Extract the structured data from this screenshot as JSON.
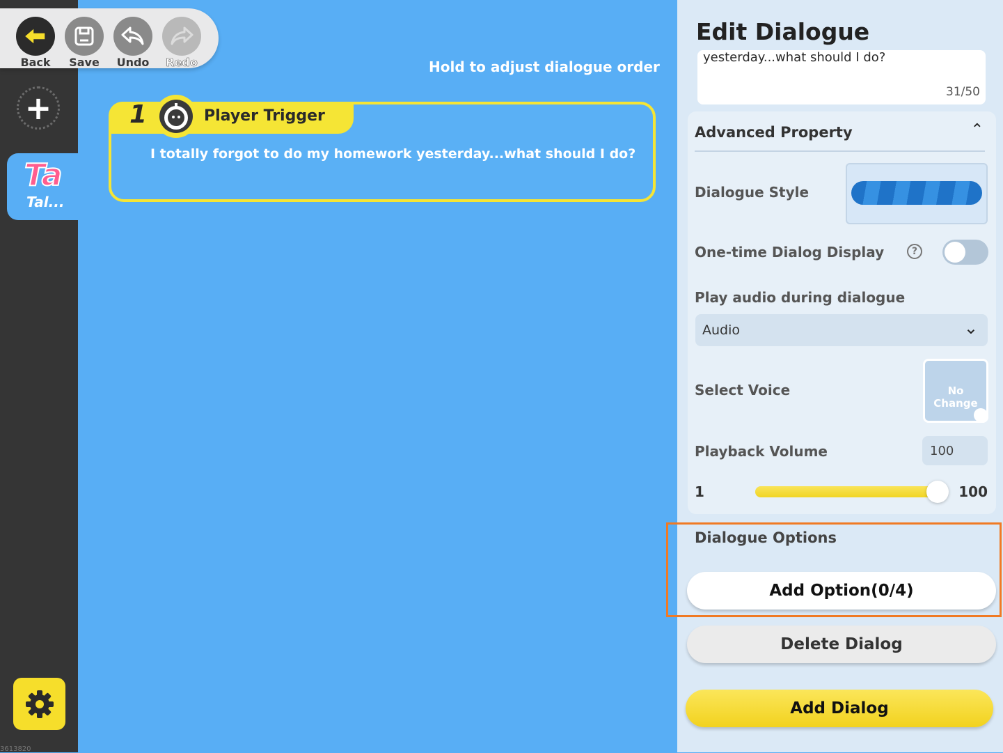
{
  "toolbar": {
    "back_label": "Back",
    "save_label": "Save",
    "undo_label": "Undo",
    "redo_label": "Redo"
  },
  "sidebar": {
    "tab_glyph": "Ta",
    "tab_label": "Tal...",
    "build_id": "3613820"
  },
  "canvas": {
    "hint": "Hold to adjust dialogue order",
    "cards": [
      {
        "index": "1",
        "trigger": "Player Trigger",
        "text": "I totally forgot to do my homework yesterday...what should I do?"
      }
    ]
  },
  "panel": {
    "title": "Edit Dialogue",
    "text_value": "yesterday...what should I do?",
    "char_count": "31/50",
    "advanced": {
      "heading": "Advanced Property",
      "dialogue_style_label": "Dialogue Style",
      "one_time_label": "One-time Dialog Display",
      "one_time_enabled": false,
      "audio_label": "Play audio during dialogue",
      "audio_value": "Audio",
      "voice_label": "Select Voice",
      "voice_value": "No Change",
      "volume_label": "Playback Volume",
      "volume_value": "100",
      "slider_min": "1",
      "slider_max": "100",
      "slider_level": 1.0
    },
    "options_label": "Dialogue Options",
    "add_option_label": "Add Option(0/4)",
    "delete_label": "Delete Dialog",
    "add_dialog_label": "Add Dialog"
  },
  "colors": {
    "canvas_bg": "#58aef5",
    "accent_yellow": "#f5e535",
    "highlight_orange": "#f07a24"
  }
}
